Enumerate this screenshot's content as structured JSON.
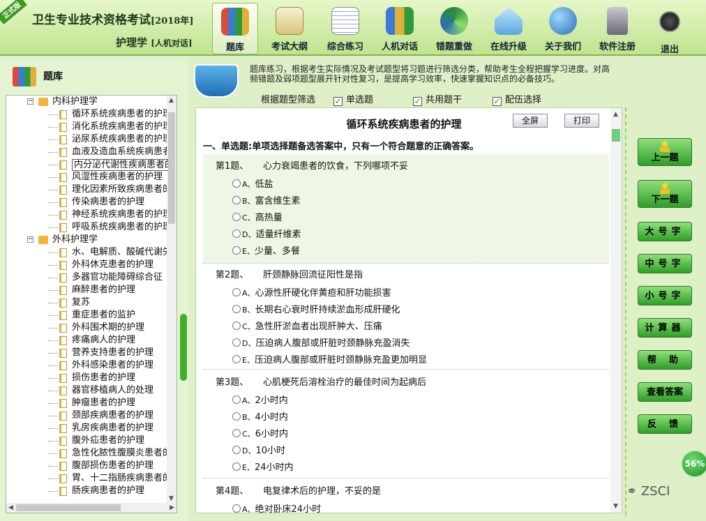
{
  "header": {
    "ribbon": "正式版",
    "title": "卫生专业技术资格考试",
    "year": "[2018年]",
    "subject": "护理学",
    "mode": "[人机对话]",
    "nav": [
      {
        "label": "题库",
        "icon": "books-icon"
      },
      {
        "label": "考试大纲",
        "icon": "outline-icon"
      },
      {
        "label": "综合练习",
        "icon": "notepad-icon"
      },
      {
        "label": "人机对话",
        "icon": "dialogue-icon"
      },
      {
        "label": "错题重做",
        "icon": "redo-icon"
      },
      {
        "label": "在线升级",
        "icon": "upgrade-icon"
      },
      {
        "label": "关于我们",
        "icon": "globe-icon"
      },
      {
        "label": "软件注册",
        "icon": "lock-icon"
      },
      {
        "label": "退出",
        "icon": "power-icon"
      }
    ]
  },
  "left": {
    "title": "题库",
    "categories": [
      {
        "label": "内科护理学",
        "items": [
          "循环系统疾病患者的护理",
          "消化系统疾病患者的护理",
          "泌尿系统疾病患者的护理",
          "血液及造血系统疾病患者的护理",
          "内分泌代谢性疾病患者的护理",
          "风湿性疾病患者的护理",
          "理化因素所致疾病患者的护理",
          "传染病患者的护理",
          "神经系统疾病患者的护理",
          "呼吸系统疾病患者的护理"
        ]
      },
      {
        "label": "外科护理学",
        "items": [
          "水、电解质、酸碱代谢失衡患者的护理",
          "外科休克患者的护理",
          "多器官功能障碍综合征",
          "麻醉患者的护理",
          "复苏",
          "重症患者的监护",
          "外科围术期的护理",
          "疼痛病人的护理",
          "营养支持患者的护理",
          "外科感染患者的护理",
          "损伤患者的护理",
          "器官移植病人的处理",
          "肿瘤患者的护理",
          "颈部疾病患者的护理",
          "乳房疾病患者的护理",
          "腹外疝患者的护理",
          "急性化脓性腹膜炎患者的护理",
          "腹部损伤患者的护理",
          "胃、十二指肠疾病患者的护理",
          "肠疾病患者的护理"
        ]
      }
    ],
    "tooltip": "内分泌代谢性疾病患者的护理"
  },
  "info": {
    "line1": "题库练习，根据考生实际情况及考试题型将习题进行筛选分类，帮助考生全程把握学习进度。对高",
    "line2": "频错题及弱项题型展开针对性复习，是提高学习效率，快速掌握知识点的必备技巧。",
    "filter_label": "根据题型筛选",
    "filters": [
      "单选题",
      "共用题干",
      "配伍选择"
    ]
  },
  "main": {
    "title": "循环系统疾病患者的护理",
    "fullscreen": "全屏",
    "print": "打印",
    "instruction": "一、单选题:单项选择题备选答案中，只有一个符合题意的正确答案。",
    "questions": [
      {
        "no": "第1题、",
        "stem": "心力衰竭患者的饮食，下列哪项不妥",
        "options": [
          [
            "A、",
            "低盐"
          ],
          [
            "B、",
            "富含维生素"
          ],
          [
            "C、",
            "高热量"
          ],
          [
            "D、",
            "适量纤维素"
          ],
          [
            "E、",
            "少量、多餐"
          ]
        ]
      },
      {
        "no": "第2题、",
        "stem": "肝颈静脉回流征阳性是指",
        "options": [
          [
            "A、",
            "心源性肝硬化伴黄疸和肝功能损害"
          ],
          [
            "B、",
            "长期右心衰时肝持续淤血形成肝硬化"
          ],
          [
            "C、",
            "急性肝淤血者出现肝肿大、压痛"
          ],
          [
            "D、",
            "压迫病人腹部或肝脏时颈静脉充盈消失"
          ],
          [
            "E、",
            "压迫病人腹部或肝脏时颈静脉充盈更加明显"
          ]
        ]
      },
      {
        "no": "第3题、",
        "stem": "心肌梗死后溶栓治疗的最佳时间为起病后",
        "options": [
          [
            "A、",
            "2小时内"
          ],
          [
            "B、",
            "4小时内"
          ],
          [
            "C、",
            "6小时内"
          ],
          [
            "D、",
            "10小时"
          ],
          [
            "E、",
            "24小时内"
          ]
        ]
      },
      {
        "no": "第4题、",
        "stem": "电复律术后的护理，不妥的是",
        "options": [
          [
            "A、",
            "绝对卧床24小时"
          ]
        ]
      }
    ]
  },
  "right": {
    "prev": "上一题",
    "next": "下一题",
    "large": "大号字",
    "medium": "中号字",
    "small": "小号字",
    "calculator": "计算器",
    "help": "帮助",
    "answer": "查看答案",
    "feedback": "反馈",
    "progress": "56%",
    "progress_value": 0.56
  },
  "watermark": "ZSCI",
  "colors": {
    "accent": "#2f9e2a",
    "header": "#bfe48f",
    "panel": "#e4f3d2"
  }
}
